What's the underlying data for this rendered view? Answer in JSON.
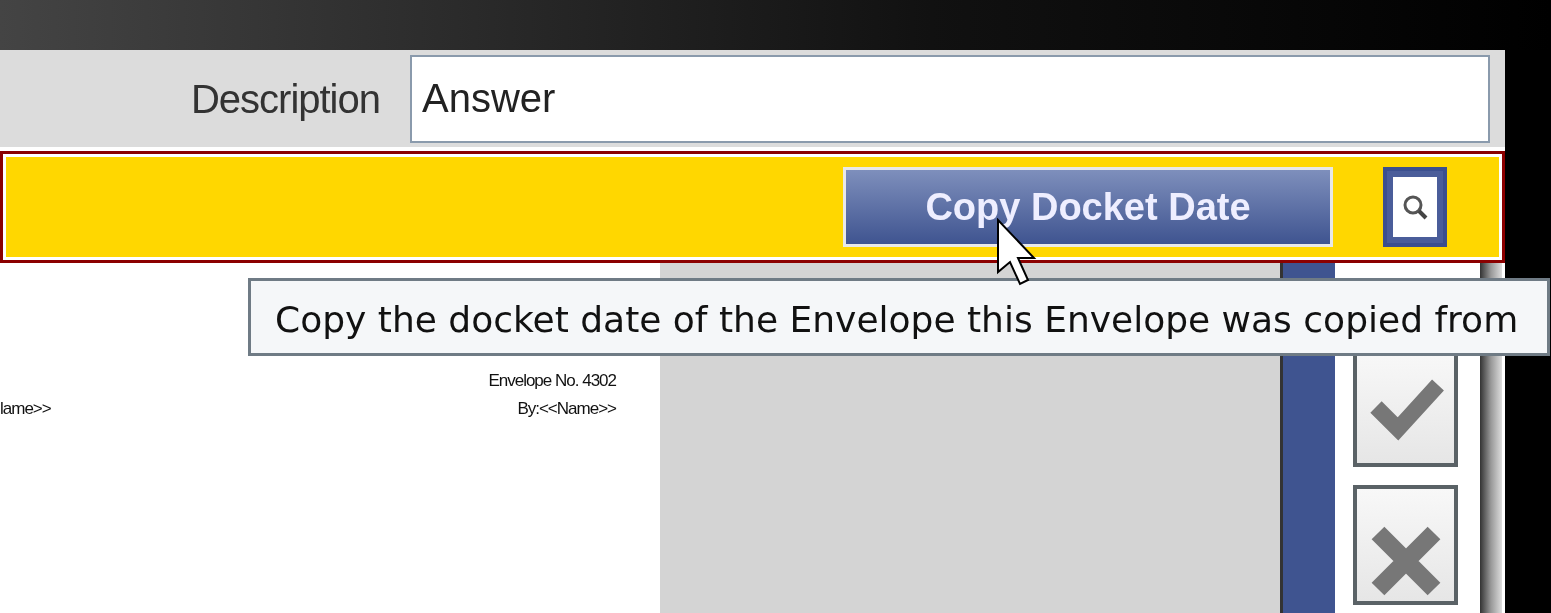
{
  "form": {
    "description_label": "Description",
    "description_value": "Answer"
  },
  "toolbar": {
    "copy_button": "Copy Docket Date"
  },
  "tooltip": "Copy the docket date of the Envelope this Envelope was copied from",
  "document": {
    "lines": [
      {
        "kind": "right",
        "text": "Envelope No. 4302"
      },
      {
        "kind": "split",
        "left": "lame>>",
        "right": "By:<<Name>>"
      }
    ]
  },
  "side_buttons": [
    {
      "kind": "accept"
    },
    {
      "kind": "discard"
    }
  ]
}
